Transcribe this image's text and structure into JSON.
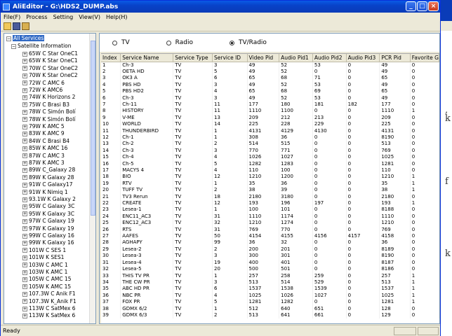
{
  "window": {
    "title": "AliEditor - G:\\HDS2_DUMP.abs",
    "controls": {
      "minimize": "_",
      "maximize": "□",
      "close": "×"
    }
  },
  "menu": [
    {
      "label": "File(F)"
    },
    {
      "label": "Process"
    },
    {
      "label": "Setting"
    },
    {
      "label": "View(V)"
    },
    {
      "label": "Help(H)"
    }
  ],
  "tree": {
    "root": "All Services",
    "satellite_group": "Satellite Information",
    "items": [
      "65W C Star OneC1",
      "65W K Star OneC1",
      "70W C Star OneC2",
      "70W K Star OneC2",
      "72W C AMC 6",
      "72W K AMC6",
      "74W K Horizons 2",
      "75W C Brasi B3",
      "78W C Simón Bolí",
      "78W K Simón Bolí",
      "79W K AMC 5",
      "83W K AMC 9",
      "84W C Brasi B4",
      "85W K AMC 16",
      "87W C AMC 3",
      "87W K AMC 3",
      "89W C_Galaxy 28",
      "89W K Galaxy 28",
      "91W C Galaxy17",
      "91W K Nimiq 1",
      "93.1W K Galaxy 2",
      "95W C Galaxy 3C",
      "95W K Galaxy 3C",
      "97W C Galaxy 19",
      "97W K Galaxy 19",
      "99W C Galaxy 16",
      "99W K Galaxy 16",
      "101W C SES 1",
      "101W K SES1",
      "103W C AMC 1",
      "103W K AMC 1",
      "105W C AMC 15",
      "105W K AMC 15",
      "107.3W C Anik F1",
      "107.3W K_Anik F1",
      "113W C SatMex 6",
      "113W K SatMex 6"
    ]
  },
  "filter": {
    "options": [
      {
        "label": "TV",
        "checked": false
      },
      {
        "label": "Radio",
        "checked": false
      },
      {
        "label": "TV/Radio",
        "checked": true
      }
    ]
  },
  "table": {
    "columns": [
      "Index",
      "Service Name",
      "Service Type",
      "Service ID",
      "Video Pid",
      "Audio Pid1",
      "Audio Pid2",
      "Audio Pid3",
      "PCR Pid",
      "Favorite G"
    ],
    "rows": [
      [
        "1",
        "Ch-3",
        "TV",
        "3",
        "49",
        "52",
        "53",
        "0",
        "49",
        "0"
      ],
      [
        "2",
        "OETA HD",
        "TV",
        "5",
        "49",
        "52",
        "0",
        "0",
        "49",
        "0"
      ],
      [
        "3",
        "OK3 A",
        "TV",
        "6",
        "65",
        "68",
        "71",
        "0",
        "65",
        "0"
      ],
      [
        "4",
        "PBS HD",
        "TV",
        "3",
        "49",
        "52",
        "53",
        "0",
        "49",
        "0"
      ],
      [
        "5",
        "PBS HD2",
        "TV",
        "4",
        "65",
        "68",
        "69",
        "0",
        "65",
        "0"
      ],
      [
        "6",
        "Ch-3",
        "TV",
        "3",
        "49",
        "52",
        "53",
        "0",
        "49",
        "0"
      ],
      [
        "7",
        "Ch-11",
        "TV",
        "11",
        "177",
        "180",
        "181",
        "182",
        "177",
        "0"
      ],
      [
        "8",
        "HISTORY",
        "TV",
        "11",
        "1110",
        "1100",
        "0",
        "0",
        "1110",
        "1"
      ],
      [
        "9",
        "V-ME",
        "TV",
        "13",
        "209",
        "212",
        "213",
        "0",
        "209",
        "0"
      ],
      [
        "10",
        "WORLD",
        "TV",
        "14",
        "225",
        "228",
        "229",
        "0",
        "225",
        "0"
      ],
      [
        "11",
        "THUNDERBIRD",
        "TV",
        "1",
        "4131",
        "4129",
        "4130",
        "0",
        "4131",
        "0"
      ],
      [
        "12",
        "Ch-1",
        "TV",
        "1",
        "308",
        "36",
        "0",
        "0",
        "8190",
        "0"
      ],
      [
        "13",
        "Ch-2",
        "TV",
        "2",
        "514",
        "515",
        "0",
        "0",
        "513",
        "0"
      ],
      [
        "14",
        "Ch-3",
        "TV",
        "3",
        "770",
        "771",
        "0",
        "0",
        "769",
        "0"
      ],
      [
        "15",
        "Ch-4",
        "TV",
        "4",
        "1026",
        "1027",
        "0",
        "0",
        "1025",
        "0"
      ],
      [
        "16",
        "Ch-5",
        "TV",
        "5",
        "1282",
        "1283",
        "0",
        "0",
        "1281",
        "0"
      ],
      [
        "17",
        "MACYS 4",
        "TV",
        "4",
        "110",
        "100",
        "0",
        "0",
        "110",
        "0"
      ],
      [
        "18",
        "BIO",
        "TV",
        "12",
        "1210",
        "1200",
        "0",
        "0",
        "1210",
        "1"
      ],
      [
        "19",
        "RTV",
        "TV",
        "1",
        "35",
        "36",
        "0",
        "0",
        "35",
        "1"
      ],
      [
        "20",
        "TUFF TV",
        "TV",
        "2",
        "38",
        "39",
        "0",
        "0",
        "38",
        "1"
      ],
      [
        "21",
        "TV3 Rerun",
        "TV",
        "18",
        "2180",
        "3180",
        "0",
        "0",
        "2180",
        "0"
      ],
      [
        "22",
        "CREATE",
        "TV",
        "12",
        "193",
        "196",
        "197",
        "0",
        "193",
        "1"
      ],
      [
        "23",
        "Lesea-1",
        "TV",
        "1",
        "100",
        "101",
        "0",
        "0",
        "8188",
        "0"
      ],
      [
        "24",
        "ENC11_AC3",
        "TV",
        "31",
        "1110",
        "1174",
        "0",
        "0",
        "1110",
        "0"
      ],
      [
        "25",
        "ENC12_AC3",
        "TV",
        "32",
        "1210",
        "1274",
        "0",
        "0",
        "1210",
        "0"
      ],
      [
        "26",
        "RTS",
        "TV",
        "31",
        "769",
        "770",
        "0",
        "0",
        "769",
        "0"
      ],
      [
        "27",
        "AAFES",
        "TV",
        "50",
        "4154",
        "4155",
        "4156",
        "4157",
        "4158",
        "0"
      ],
      [
        "28",
        "AGHAPY",
        "TV",
        "99",
        "36",
        "32",
        "0",
        "0",
        "36",
        "0"
      ],
      [
        "29",
        "Lesea-2",
        "TV",
        "2",
        "200",
        "201",
        "0",
        "0",
        "8189",
        "0"
      ],
      [
        "30",
        "Lesea-3",
        "TV",
        "3",
        "300",
        "301",
        "0",
        "0",
        "8190",
        "0"
      ],
      [
        "31",
        "Lesea-4",
        "TV",
        "19",
        "400",
        "401",
        "0",
        "0",
        "8187",
        "0"
      ],
      [
        "32",
        "Lesea-5",
        "TV",
        "20",
        "500",
        "501",
        "0",
        "0",
        "8186",
        "0"
      ],
      [
        "33",
        "THIS TV PR",
        "TV",
        "1",
        "257",
        "258",
        "259",
        "0",
        "257",
        "1"
      ],
      [
        "34",
        "THE CW PR",
        "TV",
        "3",
        "513",
        "514",
        "529",
        "0",
        "513",
        "1"
      ],
      [
        "35",
        "ABC HD PR",
        "TV",
        "6",
        "1537",
        "1538",
        "1539",
        "0",
        "1537",
        "1"
      ],
      [
        "36",
        "NBC PR",
        "TV",
        "4",
        "1025",
        "1026",
        "1027",
        "0",
        "1025",
        "1"
      ],
      [
        "37",
        "FOX PR",
        "TV",
        "5",
        "1281",
        "1282",
        "0",
        "0",
        "1281",
        "1"
      ],
      [
        "38",
        "GDMX 6/2",
        "TV",
        "1",
        "512",
        "640",
        "651",
        "0",
        "128",
        "0"
      ],
      [
        "39",
        "GDMX 6/3",
        "TV",
        "2",
        "513",
        "641",
        "661",
        "0",
        "129",
        "0"
      ]
    ]
  },
  "status": {
    "text": "Ready"
  },
  "behind_window": {
    "fragments": [
      ",",
      "k",
      "f",
      "k"
    ]
  },
  "colors": {
    "title_bar": "#0842c8",
    "selection": "#316ac5",
    "chrome": "#ece9d8"
  }
}
